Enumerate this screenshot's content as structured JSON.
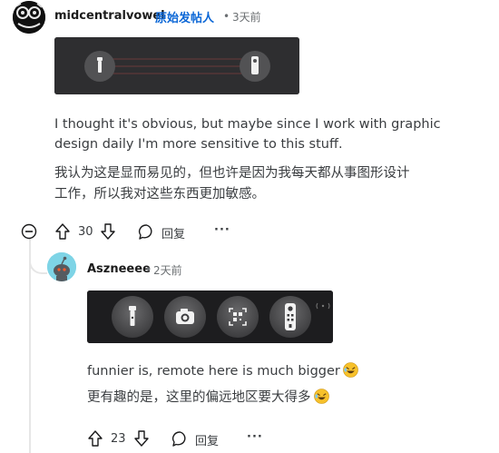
{
  "comment1": {
    "username": "midcentralvowel",
    "op_label": "原始发帖人",
    "separator": "•",
    "time": "3天前",
    "text_en_line1": "I thought it's obvious, but maybe since I work with graphic",
    "text_en_line2": "design daily I'm more sensitive to this stuff.",
    "text_cn_line1": "我认为这是显而易见的，但也许是因为我每天都从事图形设计",
    "text_cn_line2": "工作，所以我对这些东西更加敏感。",
    "upvotes": "30",
    "reply_label": "回复",
    "more_label": "···"
  },
  "comment2": {
    "username": "Aszneeee",
    "separator": "•",
    "time": "2天前",
    "text_en": "funnier is, remote here is much bigger",
    "text_cn": "更有趣的是，这里的偏远地区要大得多",
    "upvotes": "23",
    "reply_label": "回复",
    "more_label": "···"
  },
  "icons": {
    "collapse": "minus-circle-icon",
    "upvote": "arrow-up-icon",
    "downvote": "arrow-down-icon",
    "reply": "speech-bubble-icon",
    "more": "ellipsis-icon",
    "emoji": "laughing-emoji-icon",
    "flashlight": "flashlight-icon",
    "camera": "camera-icon",
    "scanner": "qr-scanner-icon",
    "remote": "remote-icon"
  },
  "colors": {
    "op_tag": "#0a66d6",
    "meta": "#6b6f72",
    "text": "#3a3d40"
  }
}
